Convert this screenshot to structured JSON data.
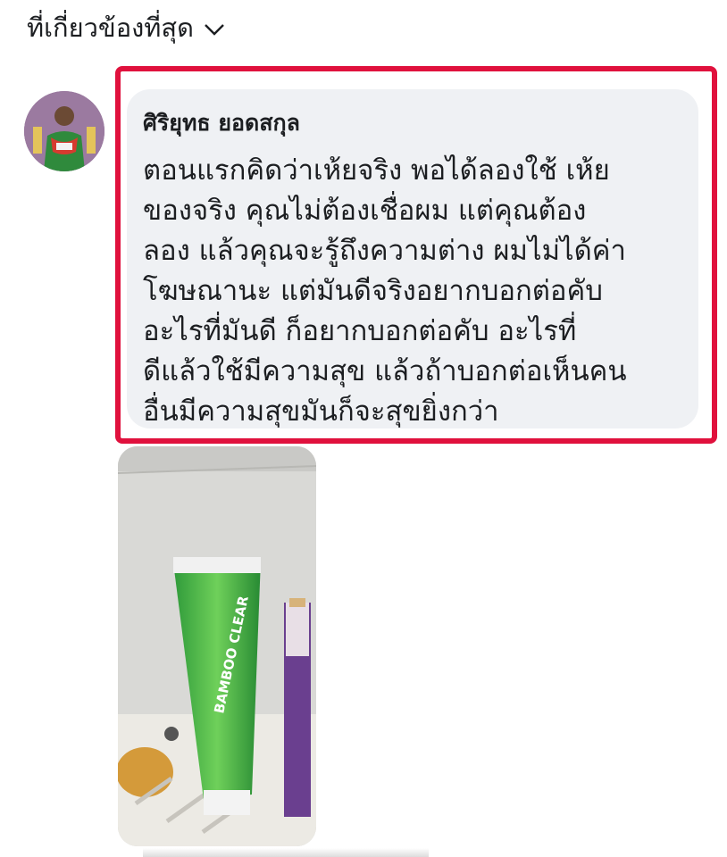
{
  "sort": {
    "label": "ที่เกี่ยวข้องที่สุด",
    "icon": "chevron-down-icon"
  },
  "comment": {
    "author": "ศิริยุทธ ยอดสกุล",
    "lines": [
      "ตอนแรกคิดว่าเห้ยจริง พอได้ลองใช้ เห้ย",
      "ของจริง คุณไม่ต้องเชื่อผม แต่คุณต้อง",
      "ลอง แล้วคุณจะรู้ถึงความต่าง ผมไม่ได้ค่า",
      "โฆษณานะ แต่มันดีจริงอยากบอกต่อคับ",
      "อะไรที่มันดี ก็อยากบอกต่อคับ อะไรที่",
      "ดีแล้วใช้มีความสุข แล้วถ้าบอกต่อเห็นคน",
      "อื่นมีความสุขมันก็จะสุขยิ่งกว่า"
    ]
  },
  "photo": {
    "product_text": "BAMBOO CLEAR"
  },
  "colors": {
    "highlight": "#e0113d",
    "bubble": "#eff1f4",
    "text": "#1c1e21"
  }
}
